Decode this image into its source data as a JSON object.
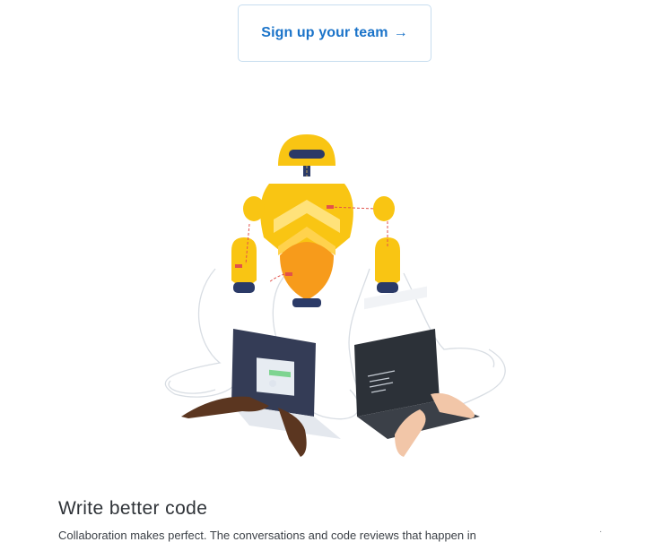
{
  "cta": {
    "label": "Sign up your team",
    "arrow": "→"
  },
  "feature": {
    "title": "Write better code",
    "body": "Collaboration makes perfect. The conversations and code reviews that happen in",
    "corner_mark": "·"
  },
  "colors": {
    "accent": "#1a73c9",
    "robot_yellow": "#f9c513",
    "robot_orange": "#f79b1b",
    "robot_navy": "#2b3a67",
    "laptop_dark": "#343c56",
    "laptop_black": "#2c3138"
  },
  "icons": {
    "arrow": "arrow-right-icon"
  }
}
